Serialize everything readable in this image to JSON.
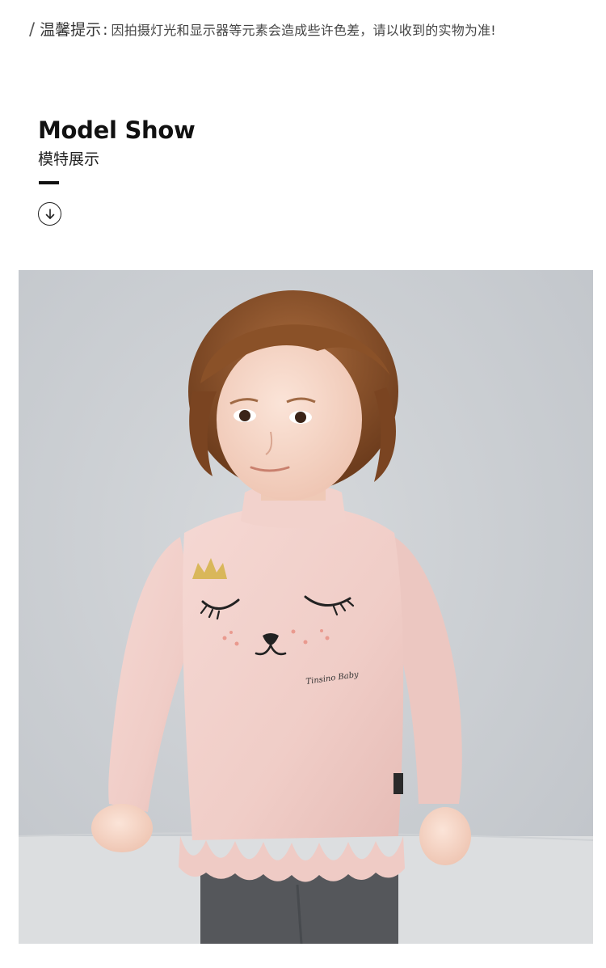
{
  "notice": {
    "slash": "/",
    "label": "温馨提示",
    "colon": ":",
    "text": "因拍摄灯光和显示器等元素会造成些许色差，请以收到的实物为准!"
  },
  "section": {
    "title_en": "Model Show",
    "title_cn": "模特展示"
  },
  "icons": {
    "scroll_down": "arrow-down-circle-icon"
  },
  "photo": {
    "sweatshirt_print": "Tinsino Baby",
    "sweatshirt_color": "#f2cfca",
    "background_color": "#cfd2d6"
  }
}
